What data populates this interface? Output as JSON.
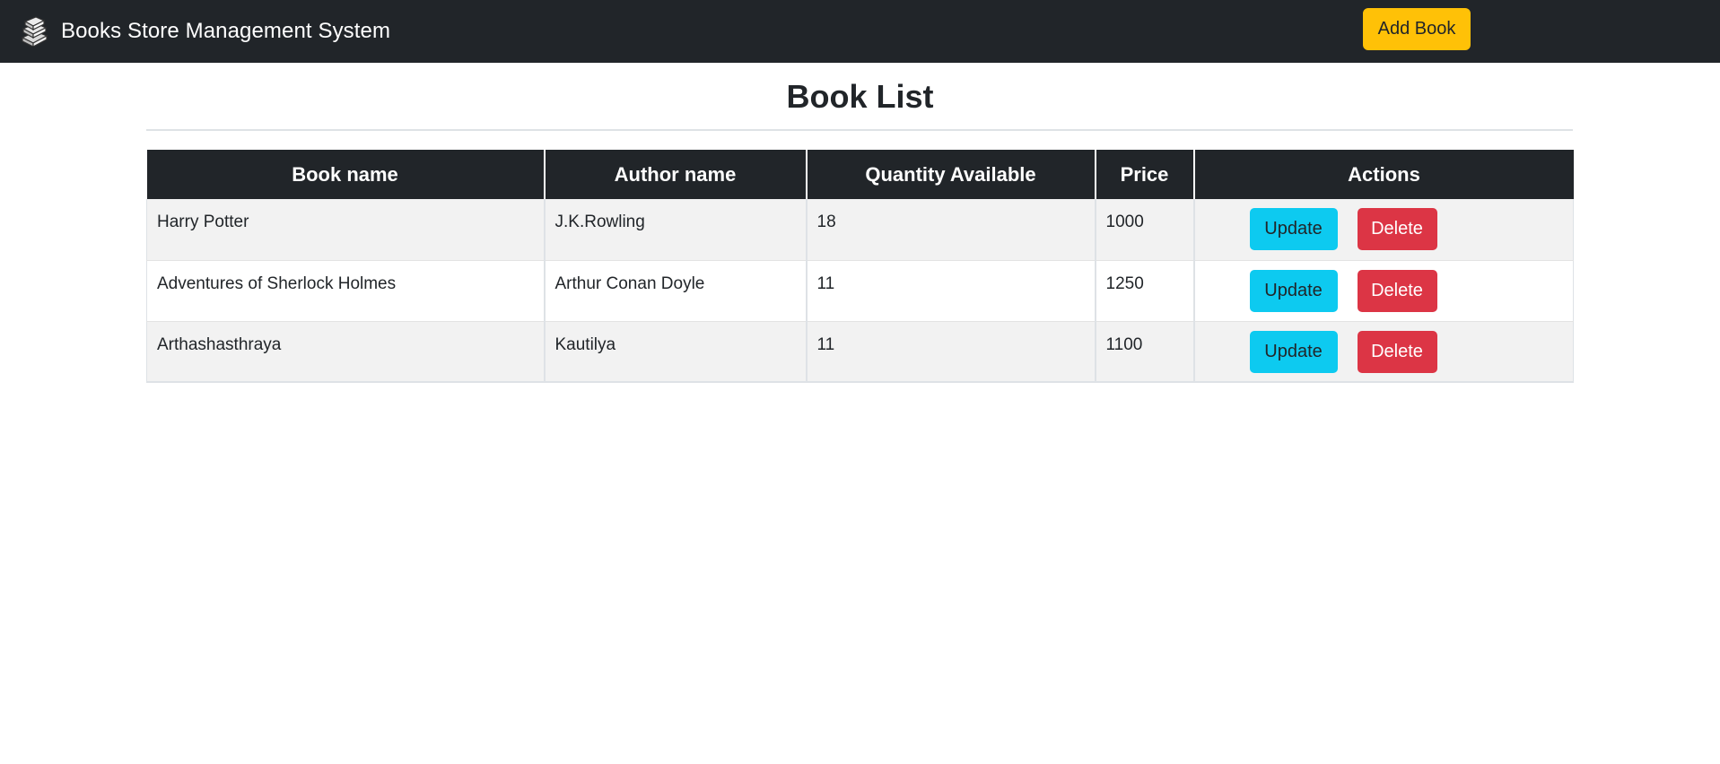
{
  "navbar": {
    "brand_icon": "books-stack-icon",
    "brand": "Books Store Management System",
    "add_button": "Add Book",
    "bg_color": "#212529",
    "add_button_color": "#ffc107"
  },
  "page": {
    "title": "Book List"
  },
  "table": {
    "headers": [
      "Book name",
      "Author name",
      "Quantity Available",
      "Price",
      "Actions"
    ],
    "rows": [
      {
        "book": "Harry Potter",
        "author": "J.K.Rowling",
        "quantity": "18",
        "price": "1000"
      },
      {
        "book": "Adventures of Sherlock Holmes",
        "author": "Arthur Conan Doyle",
        "quantity": "11",
        "price": "1250"
      },
      {
        "book": "Arthashasthraya",
        "author": "Kautilya",
        "quantity": "11",
        "price": "1100"
      }
    ],
    "update_label": "Update",
    "delete_label": "Delete",
    "update_color": "#0dcaf0",
    "delete_color": "#dc3545"
  }
}
